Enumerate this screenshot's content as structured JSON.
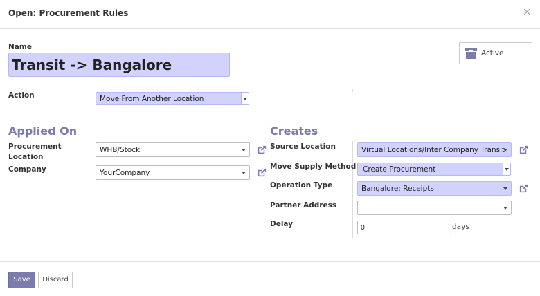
{
  "dialog": {
    "title": "Open: Procurement Rules",
    "close_glyph": "×"
  },
  "form": {
    "name_label": "Name",
    "name_value": "Transit -> Bangalore",
    "active_label": "Active",
    "action_label": "Action",
    "action_value": "Move From Another Location"
  },
  "applied_on": {
    "title": "Applied On",
    "procurement_location_label": "Procurement Location",
    "procurement_location_value": "WHB/Stock",
    "company_label": "Company",
    "company_value": "YourCompany"
  },
  "creates": {
    "title": "Creates",
    "source_location_label": "Source Location",
    "source_location_value": "Virtual Locations/Inter Company Transit",
    "move_supply_method_label": "Move Supply Method",
    "move_supply_method_value": "Create Procurement",
    "operation_type_label": "Operation Type",
    "operation_type_value": "Bangalore: Receipts",
    "partner_address_label": "Partner Address",
    "partner_address_value": "",
    "delay_label": "Delay",
    "delay_value": "0",
    "delay_unit": "days"
  },
  "footer": {
    "save_label": "Save",
    "discard_label": "Discard"
  },
  "colors": {
    "accent": "#7c7bad",
    "required_bg": "#d2d2ff"
  }
}
